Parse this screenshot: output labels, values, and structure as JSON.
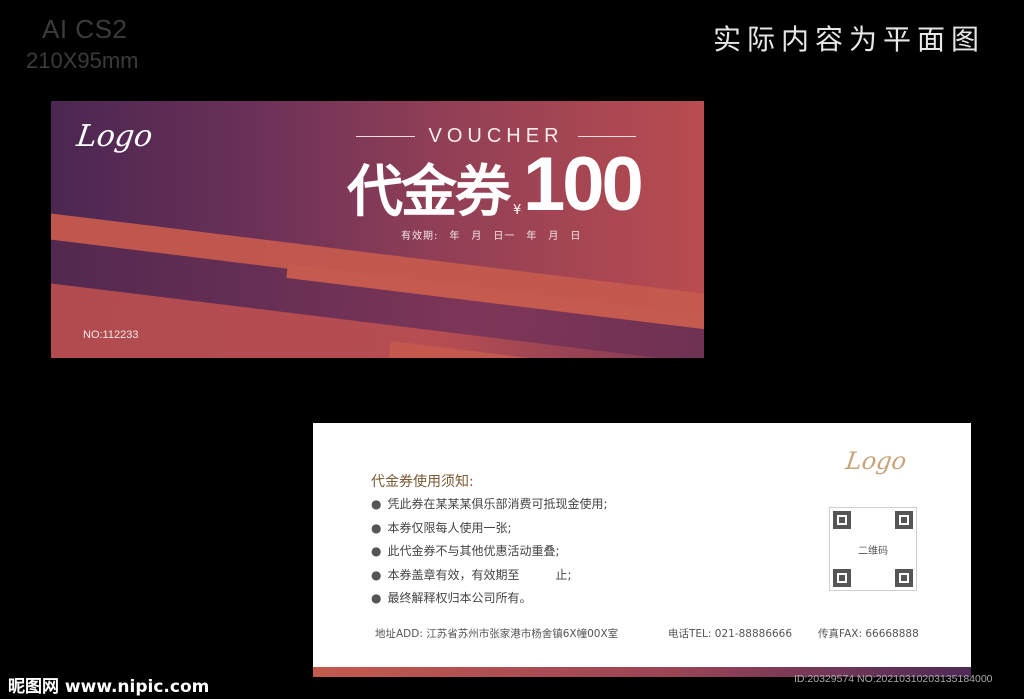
{
  "meta": {
    "format": "AI CS2",
    "size": "210X95mm"
  },
  "note": "实际内容为平面图",
  "front": {
    "logo": "Logo",
    "voucher_word": "VOUCHER",
    "title": "代金券",
    "currency": "¥",
    "amount": "100",
    "validity": "有效期:　年　月　日一　年　月　日",
    "serial": "NO:112233",
    "colors": {
      "start": "#4a2752",
      "end": "#b94c50",
      "accent": "#c55a4e"
    }
  },
  "back": {
    "logo": "Logo",
    "rules_title": "代金券使用须知:",
    "rules": [
      "凭此券在某某某俱乐部消费可抵现金使用;",
      "本券仅限每人使用一张;",
      "此代金券不与其他优惠活动重叠;",
      "本券盖章有效，有效期至　　　止;",
      "最终解释权归本公司所有。"
    ],
    "qr_label": "二维码",
    "address": "地址ADD:  江苏省苏州市张家港市杨舍镇6X幢00X室",
    "phone": "电话TEL:  021-88886666",
    "fax": "传真FAX:  66668888"
  },
  "watermark": {
    "site": "昵图网 www.nipic.com",
    "id": "ID:20329574 NO:20210310203135184000"
  }
}
